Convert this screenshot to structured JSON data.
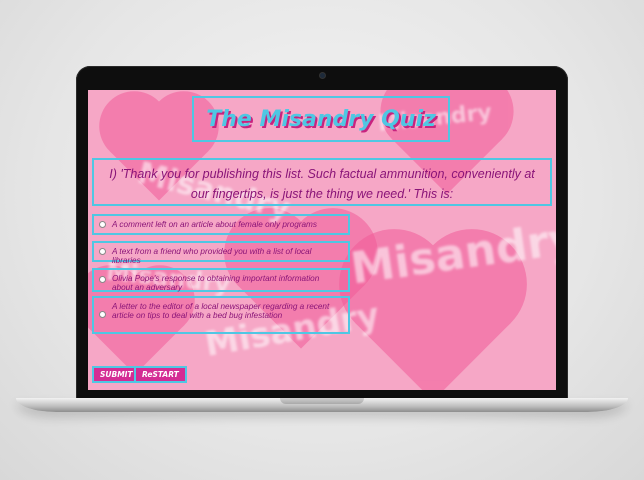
{
  "quiz": {
    "title": "The Misandry Quiz",
    "question": "I) 'Thank you for publishing this list. Such factual ammunition, conveniently at our fingertips, is just the thing we need.' This is:",
    "options": [
      {
        "label": "A comment left on an article about female only programs"
      },
      {
        "label": "A text from a friend who provided you with a list of local libraries"
      },
      {
        "label": "Olivia Pope's response to obtaining important information about an adversary"
      },
      {
        "label": "A letter to the editor of a local newspaper regarding a recent article on tips to deal with a bed bug infestation"
      }
    ],
    "submit_label": "SUBMIT",
    "restart_label": "ReSTART"
  },
  "background": {
    "words": [
      "Misandry",
      "Misandry",
      "Misandry",
      "Misandry",
      "Misandry"
    ]
  },
  "colors": {
    "accent": "#4fc7e3",
    "text": "#8a1478",
    "button": "#d42c94",
    "heart": "#f25c99"
  }
}
